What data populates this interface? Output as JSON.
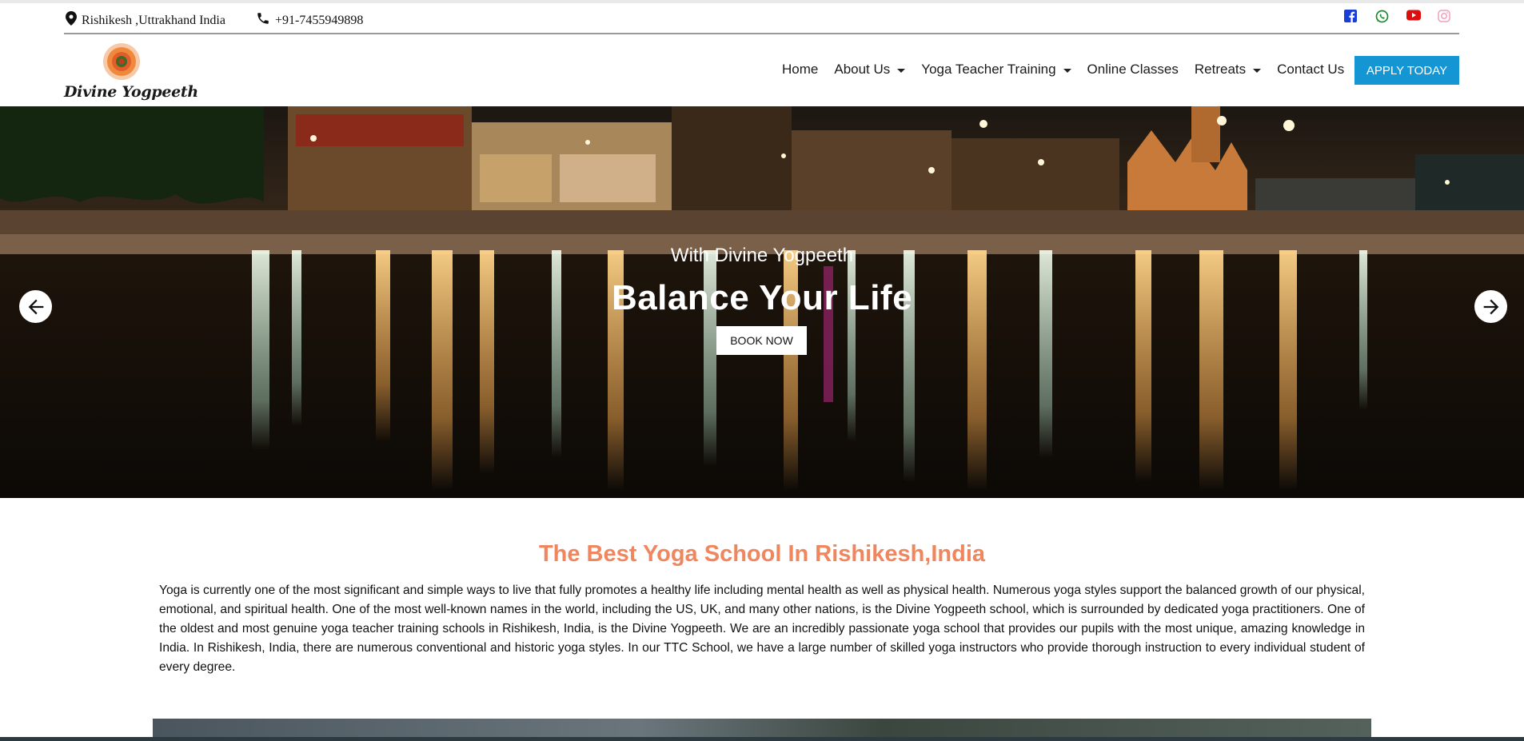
{
  "topbar": {
    "location": "Rishikesh ,Uttrakhand India",
    "phone": "+91-7455949898",
    "social": [
      {
        "icon": "facebook-icon",
        "color": "#1a3fd6"
      },
      {
        "icon": "whatsapp-icon",
        "color": "#1a8a2e"
      },
      {
        "icon": "youtube-icon",
        "color": "#e00d0d"
      },
      {
        "icon": "instagram-icon",
        "color": "#f0a0b8"
      }
    ]
  },
  "header": {
    "logo_text": "Divine Yogpeeth",
    "nav": [
      {
        "label": "Home",
        "dropdown": false
      },
      {
        "label": "About Us",
        "dropdown": true
      },
      {
        "label": "Yoga Teacher Training",
        "dropdown": true
      },
      {
        "label": "Online Classes",
        "dropdown": false
      },
      {
        "label": "Retreats",
        "dropdown": true
      },
      {
        "label": "Contact Us",
        "dropdown": false
      }
    ],
    "apply_label": "APPLY TODAY",
    "accent": "#1496d4"
  },
  "hero": {
    "subtitle": "With Divine Yogpeeth",
    "title": "Balance Your Life",
    "button": "BOOK NOW"
  },
  "intro": {
    "heading": "The Best Yoga School In Rishikesh,India",
    "heading_color": "#f0865e",
    "body": "Yoga is currently one of the most significant and simple ways to live that fully promotes a healthy life including mental health as well as physical health. Numerous yoga styles support the balanced growth of our physical, emotional, and spiritual health. One of the most well-known names in the world, including the US, UK, and many other nations, is the Divine Yogpeeth school, which is surrounded by dedicated yoga practitioners. One of the oldest and most genuine yoga teacher training schools in Rishikesh, India, is the Divine Yogpeeth. We are an incredibly passionate yoga school that provides our pupils with the most unique, amazing knowledge in India. In Rishikesh, India, there are numerous conventional and historic yoga styles. In our TTC School, we have a large number of skilled yoga instructors who provide thorough instruction to every individual student of every degree."
  }
}
